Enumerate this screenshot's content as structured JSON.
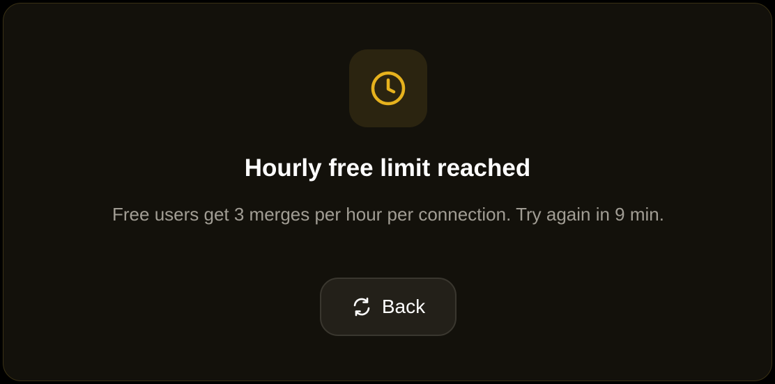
{
  "dialog": {
    "icon": "clock-icon",
    "title": "Hourly free limit reached",
    "message": "Free users get 3 merges per hour per connection. Try again in 9 min.",
    "back_button": {
      "label": "Back",
      "icon": "refresh-icon"
    }
  },
  "colors": {
    "accent": "#e6b21e",
    "background": "#13110b",
    "border": "#3a3114",
    "icon_tile": "#2b2410",
    "title_text": "#ffffff",
    "message_text": "#a19d94",
    "button_bg": "#232019",
    "button_border": "#3a372f"
  }
}
